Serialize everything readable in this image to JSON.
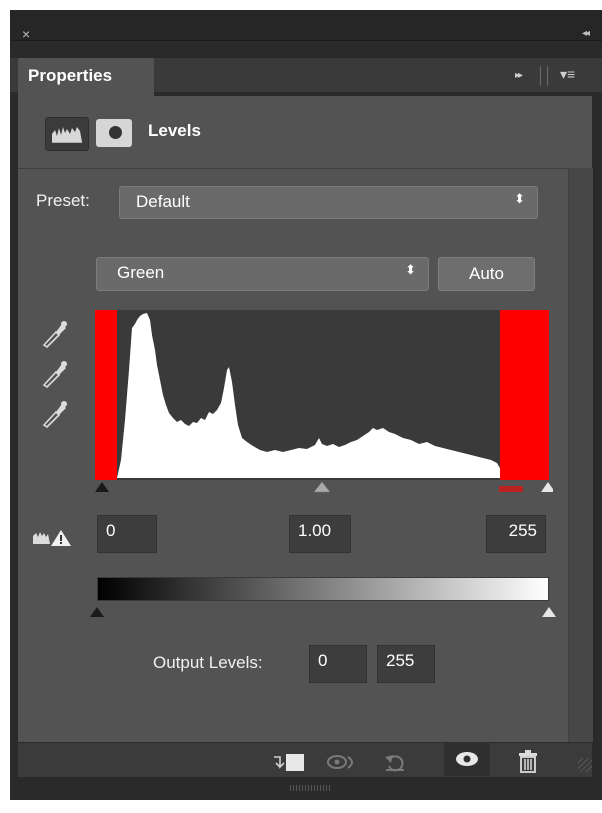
{
  "window": {
    "close_glyph": "×",
    "collapse_glyph": "◂◂"
  },
  "tab": {
    "label": "Properties",
    "expand_glyph": "▸▸",
    "menu_glyph": "▾≡"
  },
  "adjustment": {
    "title": "Levels",
    "adjustment_icon": "levels-histogram-icon",
    "mask_icon": "layer-mask-icon"
  },
  "preset": {
    "label": "Preset:",
    "value": "Default",
    "arrow": "⬍"
  },
  "channel": {
    "value": "Green",
    "arrow": "⬍"
  },
  "auto_button": {
    "label": "Auto"
  },
  "eyedroppers": [
    {
      "name": "black-point-eyedropper-icon"
    },
    {
      "name": "gray-point-eyedropper-icon"
    },
    {
      "name": "white-point-eyedropper-icon"
    }
  ],
  "histogram": {
    "clip_color": "#ff0000",
    "fill_color": "#ffffff",
    "bg_color": "#3a3a3a"
  },
  "input_levels": {
    "black": "0",
    "gamma": "1.00",
    "white": "255",
    "warning_icon": "clipping-warning-icon"
  },
  "output_levels": {
    "label": "Output Levels:",
    "black": "0",
    "white": "255"
  },
  "bottom_bar": {
    "icons": [
      {
        "name": "clip-to-layer-icon",
        "glyph": "⬚"
      },
      {
        "name": "view-previous-state-icon",
        "glyph": "◎"
      },
      {
        "name": "reset-icon",
        "glyph": "↺"
      },
      {
        "name": "visibility-eye-icon",
        "glyph": "◉"
      },
      {
        "name": "delete-trash-icon",
        "glyph": "🗑"
      }
    ]
  }
}
